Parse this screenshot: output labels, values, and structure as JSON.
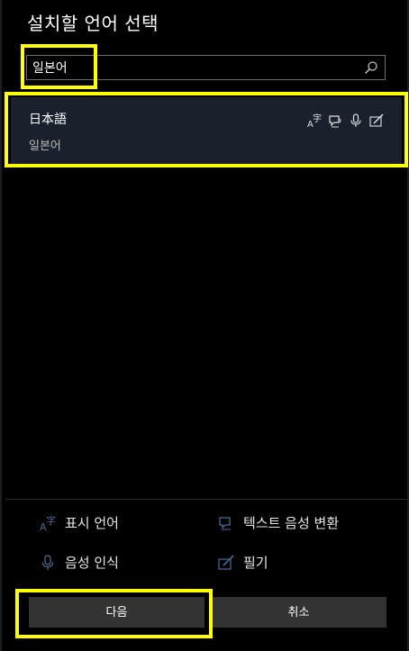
{
  "dialog": {
    "title": "설치할 언어 선택"
  },
  "search": {
    "value": "일본어",
    "placeholder": "",
    "icon": "search-icon"
  },
  "results": [
    {
      "native_name": "日本語",
      "local_name": "일본어",
      "features": [
        "display-language-icon",
        "text-to-speech-icon",
        "speech-recognition-icon",
        "handwriting-icon"
      ],
      "selected": true
    }
  ],
  "legend": {
    "display_language": "표시 언어",
    "text_to_speech": "텍스트 음성 변환",
    "speech_recognition": "음성 인식",
    "handwriting": "필기"
  },
  "buttons": {
    "next": "다음",
    "cancel": "취소"
  },
  "colors": {
    "background": "#000000",
    "selected_row": "#1a202c",
    "button": "#333333",
    "legend_icon": "#4d6a94",
    "highlight": "#ffff00"
  }
}
